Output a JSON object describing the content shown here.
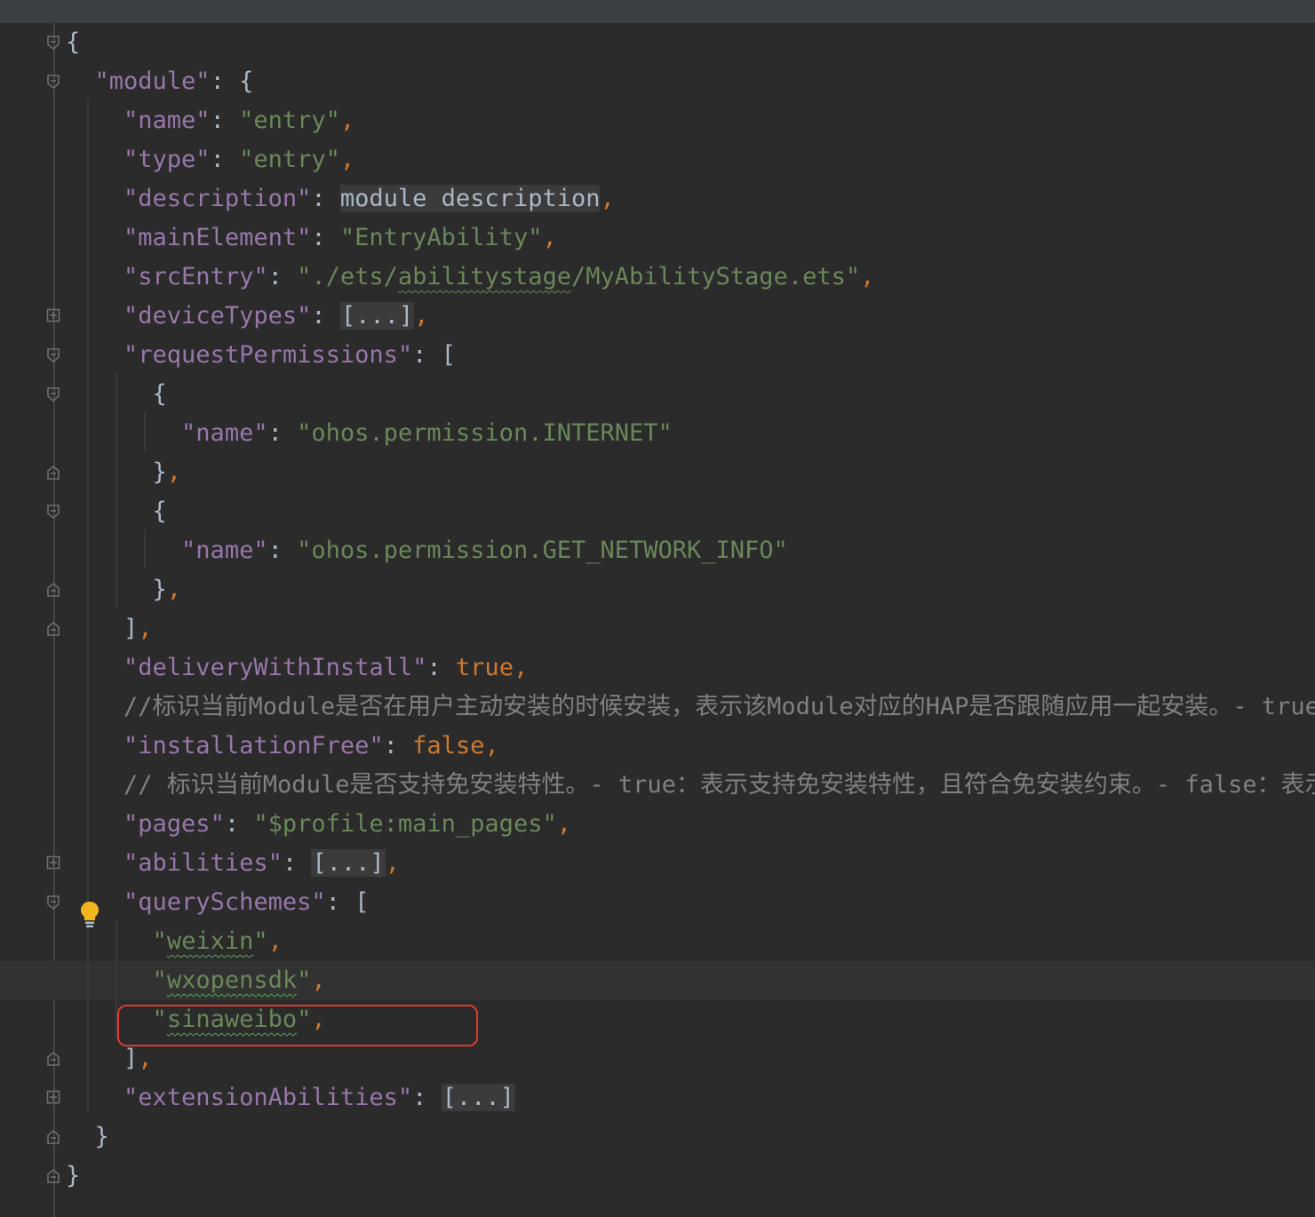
{
  "editor": {
    "lines": [
      [
        {
          "t": "{",
          "c": "b"
        }
      ],
      [
        {
          "t": "  "
        },
        {
          "t": "\"module\"",
          "c": "k"
        },
        {
          "t": ": {",
          "c": "b"
        }
      ],
      [
        {
          "t": "    "
        },
        {
          "t": "\"name\"",
          "c": "k"
        },
        {
          "t": ": ",
          "c": "b"
        },
        {
          "t": "\"entry\"",
          "c": "s"
        },
        {
          "t": ",",
          "c": "p"
        }
      ],
      [
        {
          "t": "    "
        },
        {
          "t": "\"type\"",
          "c": "k"
        },
        {
          "t": ": ",
          "c": "b"
        },
        {
          "t": "\"entry\"",
          "c": "s"
        },
        {
          "t": ",",
          "c": "p"
        }
      ],
      [
        {
          "t": "    "
        },
        {
          "t": "\"description\"",
          "c": "k"
        },
        {
          "t": ": ",
          "c": "b"
        },
        {
          "t": "module description",
          "c": "plain-ph"
        },
        {
          "t": ",",
          "c": "p"
        }
      ],
      [
        {
          "t": "    "
        },
        {
          "t": "\"mainElement\"",
          "c": "k"
        },
        {
          "t": ": ",
          "c": "b"
        },
        {
          "t": "\"EntryAbility\"",
          "c": "s"
        },
        {
          "t": ",",
          "c": "p"
        }
      ],
      [
        {
          "t": "    "
        },
        {
          "t": "\"srcEntry\"",
          "c": "k"
        },
        {
          "t": ": ",
          "c": "b"
        },
        {
          "t": "\"./ets/",
          "c": "s"
        },
        {
          "t": "abilitystage",
          "c": "s squig"
        },
        {
          "t": "/MyAbilityStage.ets\"",
          "c": "s"
        },
        {
          "t": ",",
          "c": "p"
        }
      ],
      [
        {
          "t": "    "
        },
        {
          "t": "\"deviceTypes\"",
          "c": "k"
        },
        {
          "t": ": ",
          "c": "b"
        },
        {
          "t": "[...]",
          "c": "fold-ph"
        },
        {
          "t": ",",
          "c": "p"
        }
      ],
      [
        {
          "t": "    "
        },
        {
          "t": "\"requestPermissions\"",
          "c": "k"
        },
        {
          "t": ": [",
          "c": "b"
        }
      ],
      [
        {
          "t": "      {",
          "c": "b"
        }
      ],
      [
        {
          "t": "        "
        },
        {
          "t": "\"name\"",
          "c": "k"
        },
        {
          "t": ": ",
          "c": "b"
        },
        {
          "t": "\"ohos.permission.INTERNET\"",
          "c": "s"
        }
      ],
      [
        {
          "t": "      }",
          "c": "b"
        },
        {
          "t": ",",
          "c": "p"
        }
      ],
      [
        {
          "t": "      {",
          "c": "b"
        }
      ],
      [
        {
          "t": "        "
        },
        {
          "t": "\"name\"",
          "c": "k"
        },
        {
          "t": ": ",
          "c": "b"
        },
        {
          "t": "\"ohos.permission.GET_NETWORK_INFO\"",
          "c": "s"
        }
      ],
      [
        {
          "t": "      }",
          "c": "b"
        },
        {
          "t": ",",
          "c": "p"
        }
      ],
      [
        {
          "t": "    ]",
          "c": "b"
        },
        {
          "t": ",",
          "c": "p"
        }
      ],
      [
        {
          "t": "    "
        },
        {
          "t": "\"deliveryWithInstall\"",
          "c": "k"
        },
        {
          "t": ": ",
          "c": "b"
        },
        {
          "t": "true",
          "c": "p"
        },
        {
          "t": ",",
          "c": "p"
        }
      ],
      [
        {
          "t": "    "
        },
        {
          "t": "//标识当前Module是否在用户主动安装的时候安装，表示该Module对应的HAP是否跟随应用一起安装。- true：主",
          "c": "c"
        }
      ],
      [
        {
          "t": "    "
        },
        {
          "t": "\"installationFree\"",
          "c": "k"
        },
        {
          "t": ": ",
          "c": "b"
        },
        {
          "t": "false",
          "c": "p"
        },
        {
          "t": ",",
          "c": "p"
        }
      ],
      [
        {
          "t": "    "
        },
        {
          "t": "// 标识当前Module是否支持免安装特性。- true：表示支持免安装特性，且符合免安装约束。- false：表示不支",
          "c": "c"
        }
      ],
      [
        {
          "t": "    "
        },
        {
          "t": "\"pages\"",
          "c": "k"
        },
        {
          "t": ": ",
          "c": "b"
        },
        {
          "t": "\"$profile:main_pages\"",
          "c": "s"
        },
        {
          "t": ",",
          "c": "p"
        }
      ],
      [
        {
          "t": "    "
        },
        {
          "t": "\"abilities\"",
          "c": "k"
        },
        {
          "t": ": ",
          "c": "b"
        },
        {
          "t": "[...]",
          "c": "fold-ph"
        },
        {
          "t": ",",
          "c": "p"
        }
      ],
      [
        {
          "t": "    "
        },
        {
          "t": "\"querySchemes\"",
          "c": "k"
        },
        {
          "t": ": [",
          "c": "b"
        }
      ],
      [
        {
          "t": "      "
        },
        {
          "t": "\"",
          "c": "s"
        },
        {
          "t": "weixin",
          "c": "s squig2"
        },
        {
          "t": "\"",
          "c": "s"
        },
        {
          "t": ",",
          "c": "p"
        }
      ],
      [
        {
          "t": "      "
        },
        {
          "t": "\"",
          "c": "s"
        },
        {
          "t": "wxopensdk",
          "c": "s squig2"
        },
        {
          "t": "\"",
          "c": "s"
        },
        {
          "t": ",",
          "c": "p"
        }
      ],
      [
        {
          "t": "      "
        },
        {
          "t": "\"",
          "c": "s"
        },
        {
          "t": "sinaweibo",
          "c": "s squig2"
        },
        {
          "t": "\"",
          "c": "s"
        },
        {
          "t": ",",
          "c": "p"
        }
      ],
      [
        {
          "t": "    ]",
          "c": "b"
        },
        {
          "t": ",",
          "c": "p"
        }
      ],
      [
        {
          "t": "    "
        },
        {
          "t": "\"extensionAbilities\"",
          "c": "k"
        },
        {
          "t": ": ",
          "c": "b"
        },
        {
          "t": "[...]",
          "c": "fold-ph"
        }
      ],
      [
        {
          "t": "  }",
          "c": "b"
        }
      ],
      [
        {
          "t": "}",
          "c": "b"
        }
      ]
    ],
    "fold_markers": [
      {
        "line": 0,
        "kind": "open"
      },
      {
        "line": 1,
        "kind": "open"
      },
      {
        "line": 7,
        "kind": "plus"
      },
      {
        "line": 8,
        "kind": "open"
      },
      {
        "line": 9,
        "kind": "open"
      },
      {
        "line": 11,
        "kind": "close"
      },
      {
        "line": 12,
        "kind": "open"
      },
      {
        "line": 14,
        "kind": "close"
      },
      {
        "line": 15,
        "kind": "close"
      },
      {
        "line": 21,
        "kind": "plus"
      },
      {
        "line": 22,
        "kind": "open"
      },
      {
        "line": 26,
        "kind": "close"
      },
      {
        "line": 27,
        "kind": "plus"
      },
      {
        "line": 28,
        "kind": "close"
      },
      {
        "line": 29,
        "kind": "close"
      }
    ],
    "caret_line": 24,
    "highlighted_line": 25,
    "intention_bulb_line": 23
  },
  "colors": {
    "background": "#2b2b2b",
    "key": "#9876aa",
    "string": "#6a8759",
    "keyword": "#cc7832",
    "comment": "#808080",
    "highlight_box": "#e03a2f",
    "bulb": "#f2b61d"
  }
}
